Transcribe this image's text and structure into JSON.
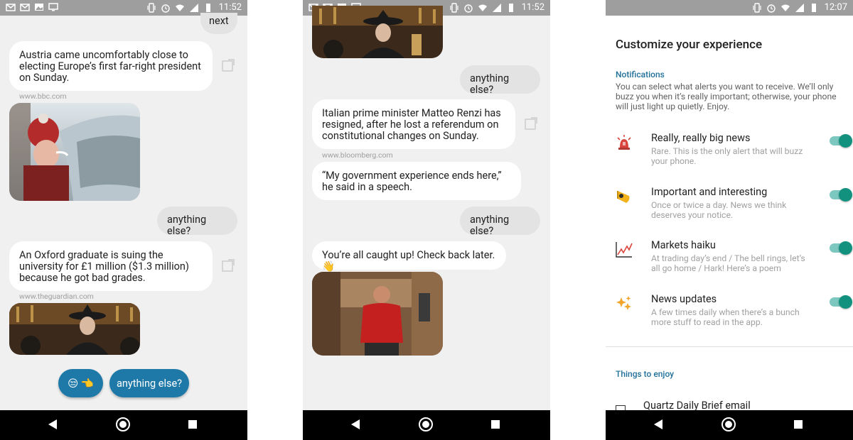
{
  "phone1": {
    "status_time": "11:52",
    "messages": {
      "next": "next",
      "austria": "Austria came uncomfortably close to electing Europe’s first far-right president on Sunday.",
      "austria_source": "www.bbc.com",
      "anything1": "anything else?",
      "oxford": "An Oxford graduate is suing the university for £1 million ($1.3 million) because he got bad grades.",
      "oxford_source": "www.theguardian.com"
    },
    "buttons": {
      "emoji": "😒 👈",
      "anything_else": "anything else?"
    }
  },
  "phone2": {
    "status_time": "11:52",
    "messages": {
      "anything1": "anything else?",
      "renzi": "Italian prime minister Matteo Renzi has resigned, after he lost a referendum on constitutional changes on Sunday.",
      "renzi_source": "www.bloomberg.com",
      "quote": "“My government experience ends here,” he said in a speech.",
      "anything2": "anything else?",
      "caught_up": "You’re all caught up! Check back later. 👋"
    }
  },
  "phone3": {
    "status_time": "12:07",
    "title": "Customize your experience",
    "notifications_heading": "Notifications",
    "notifications_desc": "You can select what alerts you want to receive. We’ll only buzz you when it’s really important; otherwise, your phone will just light up quietly. Enjoy.",
    "settings": [
      {
        "title": "Really, really big news",
        "desc": "Rare. This is the only alert that will buzz your phone.",
        "icon": "siren-icon",
        "enabled": true
      },
      {
        "title": "Important and interesting",
        "desc": "Once or twice a day. News we think deserves your notice.",
        "icon": "megaphone-icon",
        "enabled": true
      },
      {
        "title": "Markets haiku",
        "desc": "At trading day’s end / The bell rings, let’s all go home / Hark! Here’s a poem",
        "icon": "chart-icon",
        "enabled": true
      },
      {
        "title": "News updates",
        "desc": "A few times daily when there’s a bunch more stuff to read in the app.",
        "icon": "sparkles-icon",
        "enabled": true
      }
    ],
    "things_heading": "Things to enjoy",
    "daily_brief": "Quartz Daily Brief email"
  },
  "colors": {
    "accent_blue": "#1e79a8",
    "toggle_on": "#12917f",
    "section_blue": "#1f6f99"
  }
}
